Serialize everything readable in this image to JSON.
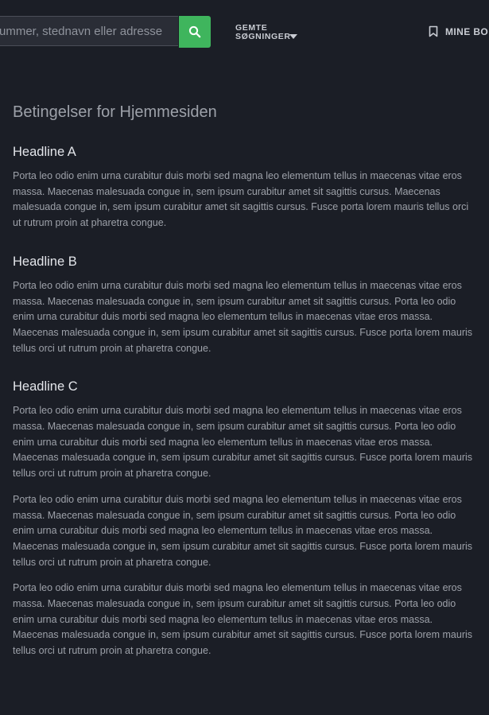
{
  "header": {
    "search_placeholder": "ummer, stednavn eller adresse",
    "saved_searches_label": "GEMTE SØGNINGER",
    "my_link_label": "MINE BO"
  },
  "main": {
    "page_title": "Betingelser for Hjemmesiden",
    "sections": [
      {
        "heading": "Headline A",
        "paragraphs": [
          "Porta leo odio enim urna curabitur duis morbi sed magna leo elementum tellus in maecenas vitae eros massa. Maecenas malesuada congue in, sem ipsum curabitur amet sit sagittis cursus. Maecenas malesuada congue in, sem ipsum curabitur amet sit sagittis cursus. Fusce porta lorem mauris tellus orci ut rutrum proin at pharetra congue."
        ]
      },
      {
        "heading": "Headline B",
        "paragraphs": [
          "Porta leo odio enim urna curabitur duis morbi sed magna leo elementum tellus in maecenas vitae eros massa. Maecenas malesuada congue in, sem ipsum curabitur amet sit sagittis cursus. Porta leo odio enim urna curabitur duis morbi sed magna leo elementum tellus in maecenas vitae eros massa. Maecenas malesuada congue in, sem ipsum curabitur amet sit sagittis cursus. Fusce porta lorem mauris tellus orci ut rutrum proin at pharetra congue."
        ]
      },
      {
        "heading": "Headline C",
        "paragraphs": [
          "Porta leo odio enim urna curabitur duis morbi sed magna leo elementum tellus in maecenas vitae eros massa. Maecenas malesuada congue in, sem ipsum curabitur amet sit sagittis cursus. Porta leo odio enim urna curabitur duis morbi sed magna leo elementum tellus in maecenas vitae eros massa. Maecenas malesuada congue in, sem ipsum curabitur amet sit sagittis cursus. Fusce porta lorem mauris tellus orci ut rutrum proin at pharetra congue.",
          "Porta leo odio enim urna curabitur duis morbi sed magna leo elementum tellus in maecenas vitae eros massa. Maecenas malesuada congue in, sem ipsum curabitur amet sit sagittis cursus. Porta leo odio enim urna curabitur duis morbi sed magna leo elementum tellus in maecenas vitae eros massa. Maecenas malesuada congue in, sem ipsum curabitur amet sit sagittis cursus. Fusce porta lorem mauris tellus orci ut rutrum proin at pharetra congue.",
          "Porta leo odio enim urna curabitur duis morbi sed magna leo elementum tellus in maecenas vitae eros massa. Maecenas malesuada congue in, sem ipsum curabitur amet sit sagittis cursus. Porta leo odio enim urna curabitur duis morbi sed magna leo elementum tellus in maecenas vitae eros massa. Maecenas malesuada congue in, sem ipsum curabitur amet sit sagittis cursus. Fusce porta lorem mauris tellus orci ut rutrum proin at pharetra congue."
        ]
      }
    ]
  },
  "icons": {
    "search": "search-icon",
    "caret": "caret-down-icon",
    "bookmark": "bookmark-icon"
  },
  "colors": {
    "background": "#1b1e26",
    "accent": "#3fb55d",
    "heading_text": "#e3e5ea",
    "body_text": "#9da1a9"
  }
}
